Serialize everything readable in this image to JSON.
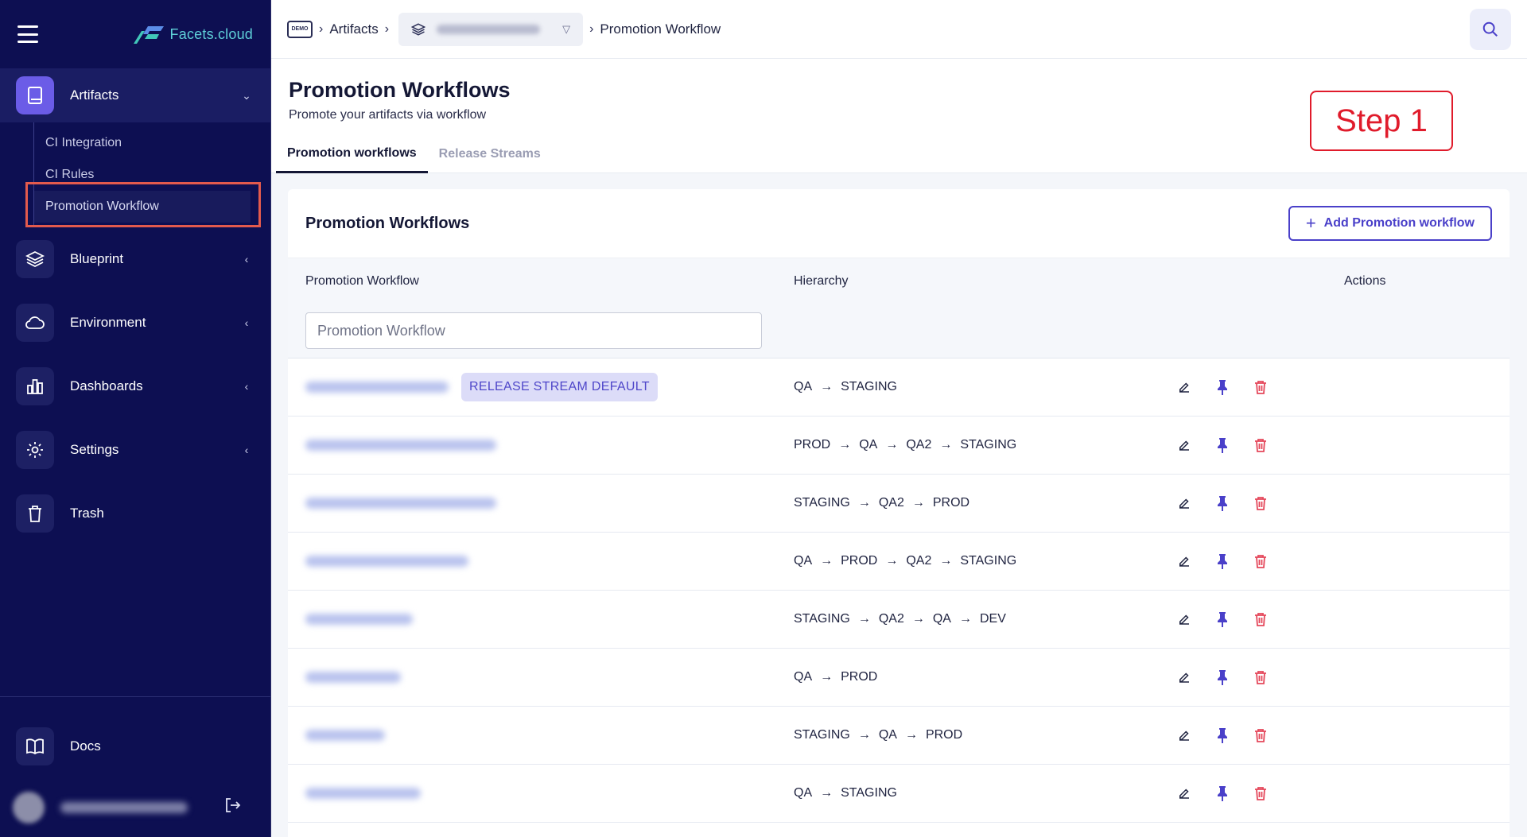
{
  "brand": {
    "name": "Facets.cloud"
  },
  "sidebar": {
    "artifacts": {
      "label": "Artifacts",
      "icon": "book-icon"
    },
    "subitems": [
      {
        "label": "CI Integration"
      },
      {
        "label": "CI Rules"
      },
      {
        "label": "Promotion Workflow"
      }
    ],
    "items": [
      {
        "label": "Blueprint",
        "icon": "layers-icon"
      },
      {
        "label": "Environment",
        "icon": "cloud-icon"
      },
      {
        "label": "Dashboards",
        "icon": "bar-chart-icon"
      },
      {
        "label": "Settings",
        "icon": "gear-icon"
      },
      {
        "label": "Trash",
        "icon": "trash-icon"
      }
    ],
    "docs": {
      "label": "Docs",
      "icon": "open-book-icon"
    }
  },
  "topbar": {
    "demo_badge": "DEMO",
    "crumb_artifacts": "Artifacts",
    "crumb_current": "Promotion Workflow"
  },
  "header": {
    "title": "Promotion Workflows",
    "subtitle": "Promote your artifacts via workflow",
    "tabs": [
      {
        "label": "Promotion workflows",
        "active": true
      },
      {
        "label": "Release Streams",
        "active": false
      }
    ],
    "annotation": "Step 1"
  },
  "card": {
    "title": "Promotion Workflows",
    "add_button": "Add Promotion workflow",
    "columns": {
      "name": "Promotion Workflow",
      "hierarchy": "Hierarchy",
      "actions": "Actions"
    },
    "filter_placeholder": "Promotion Workflow",
    "badge": "RELEASE STREAM DEFAULT",
    "rows": [
      {
        "hierarchy": [
          "QA",
          "STAGING"
        ],
        "default": true
      },
      {
        "hierarchy": [
          "PROD",
          "QA",
          "QA2",
          "STAGING"
        ],
        "default": false
      },
      {
        "hierarchy": [
          "STAGING",
          "QA2",
          "PROD"
        ],
        "default": false
      },
      {
        "hierarchy": [
          "QA",
          "PROD",
          "QA2",
          "STAGING"
        ],
        "default": false
      },
      {
        "hierarchy": [
          "STAGING",
          "QA2",
          "QA",
          "DEV"
        ],
        "default": false
      },
      {
        "hierarchy": [
          "QA",
          "PROD"
        ],
        "default": false
      },
      {
        "hierarchy": [
          "STAGING",
          "QA",
          "PROD"
        ],
        "default": false
      },
      {
        "hierarchy": [
          "QA",
          "STAGING"
        ],
        "default": false
      }
    ]
  },
  "colors": {
    "sidebar": "#0d0f52",
    "accent": "#4a40c9",
    "danger": "#e5485b",
    "annotation": "#e01b2b"
  }
}
